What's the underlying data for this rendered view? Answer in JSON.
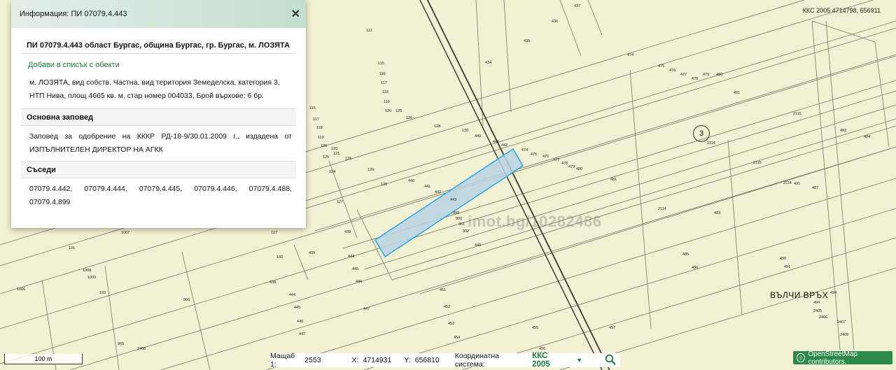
{
  "header": {
    "title": "Информация: ПИ 07079.4.443"
  },
  "property": {
    "title": "ПИ 07079.4.443 област Бургас, община Бургас, гр. Бургас, м. ЛОЗЯТА",
    "add_link": "Добави в списък с обекти",
    "description": "м. ЛОЗЯТА, вид собств. Частна, вид територия Земеделска, категория 3, НТП Нива, площ 4665 кв. м, стар номер 004033, Брой върхове: 6 бр."
  },
  "order": {
    "heading": "Основна заповед",
    "text": "Заповед за одобрение на КККР РД-18-9/30.01.2009 г., издадена от ИЗПЪЛНИТЕЛЕН ДИРЕКТОР НА АГКК"
  },
  "neighbors": {
    "heading": "Съседи",
    "text": "07079.4.442, 07079.4.444, 07079.4.445, 07079.4.446, 07079.4.488, 07079.4.899"
  },
  "map": {
    "coords_top": "ККС 2005 4714798, 656911",
    "watermark": "imot.bg/10282486",
    "area_label": "ВЪЛЧИ ВРЪХ",
    "circle_label": "3",
    "scale_bar": "100 m",
    "parcel_labels": [
      "112",
      "115",
      "116",
      "117",
      "118",
      "119",
      "120",
      "125",
      "126",
      "128",
      "130",
      "440",
      "441",
      "442",
      "443",
      "899",
      "900",
      "901",
      "902",
      "449",
      "439",
      "444",
      "445",
      "446",
      "447",
      "451",
      "452",
      "453",
      "454",
      "455",
      "456",
      "457",
      "474",
      "475",
      "476",
      "477",
      "478",
      "479",
      "480",
      "481",
      "483",
      "485",
      "486",
      "490",
      "491",
      "2114",
      "2115",
      "435",
      "436",
      "437",
      "434",
      "1006",
      "1008",
      "1009",
      "191",
      "193",
      "966",
      "965",
      "127",
      "138",
      "438",
      "439"
    ],
    "colors": {
      "map_bg": "#f2f1d3",
      "line": "#6b6b5a",
      "highlight_fill": "#b9d3e3",
      "highlight_stroke": "#2aa6e6"
    }
  },
  "status": {
    "scale_label": "Мащаб 1:",
    "scale_value": "2553",
    "x_label": "X:",
    "x_value": "4714931",
    "y_label": "Y:",
    "y_value": "656810",
    "system_label": "Координатна система:",
    "system_value": "ККС 2005",
    "search_icon": "search-icon"
  },
  "osm": {
    "text": "OpenStreetMap contributors."
  },
  "accent": "#1e7a3e"
}
